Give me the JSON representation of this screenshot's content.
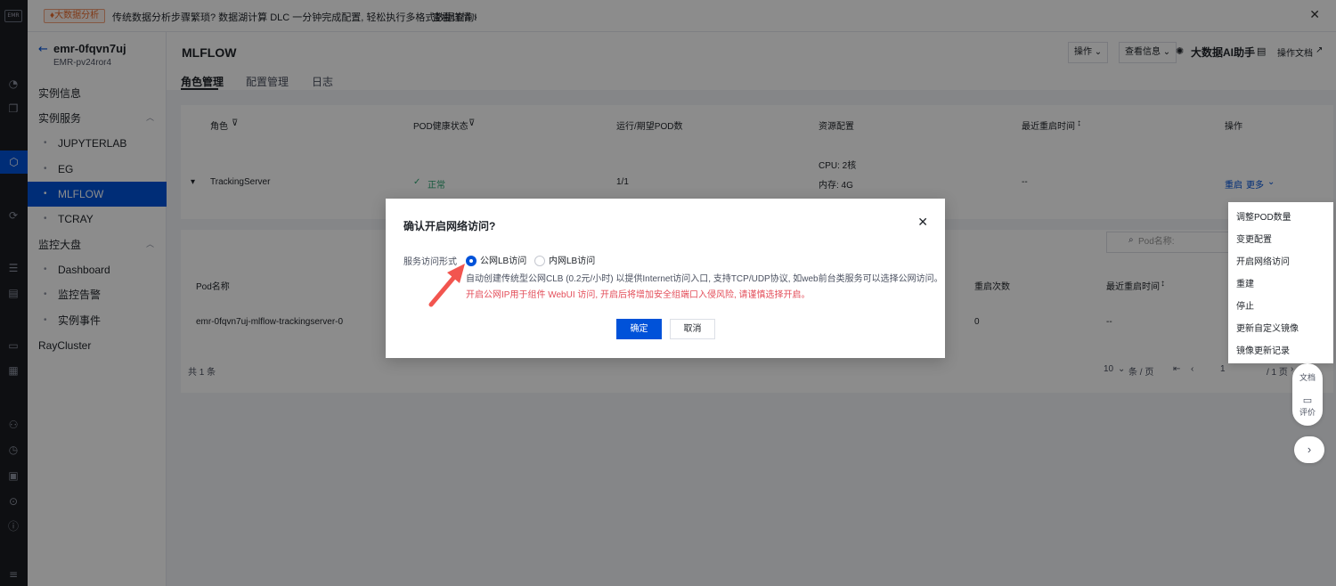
{
  "rail": {
    "logo": "EMR"
  },
  "banner": {
    "tag": "♦大数据分析",
    "message": "传统数据分析步骤繁琐? 数据湖计算 DLC 一分钟完成配置, 轻松执行多格式数据查询!",
    "more": "查看详情 ›"
  },
  "sidebar": {
    "instance_name": "emr-0fqvn7uj",
    "instance_id": "EMR-pv24ror4",
    "items": [
      {
        "label": "实例信息"
      },
      {
        "label": "实例服务"
      },
      {
        "label": "JUPYTERLAB"
      },
      {
        "label": "EG"
      },
      {
        "label": "MLFLOW"
      },
      {
        "label": "TCRAY"
      },
      {
        "label": "监控大盘"
      },
      {
        "label": "Dashboard"
      },
      {
        "label": "监控告警"
      },
      {
        "label": "实例事件"
      },
      {
        "label": "RayCluster"
      }
    ]
  },
  "header": {
    "title": "MLFLOW",
    "tabs": [
      "角色管理",
      "配置管理",
      "日志"
    ],
    "ops_btn": "操作 ⌄",
    "info_btn": "查看信息 ⌄",
    "ai": "大数据AI助手",
    "docs": "操作文档"
  },
  "role_table": {
    "headers": [
      "角色",
      "POD健康状态",
      "运行/期望POD数",
      "资源配置",
      "最近重启时间",
      "操作"
    ],
    "row": {
      "role": "TrackingServer",
      "health": "正常",
      "pods": "1/1",
      "cpu": "CPU: 2核",
      "mem": "内存: 4G",
      "restart_time": "--",
      "restart": "重启",
      "more": "更多"
    }
  },
  "pod_table": {
    "search_placeholder": "Pod名称:",
    "headers": [
      "Pod名称",
      "重启次数",
      "最近重启时间"
    ],
    "row": {
      "name": "emr-0fqvn7uj-mlflow-trackingserver-0",
      "restarts": "0",
      "restart_time": "--"
    },
    "total": "共 1 条",
    "page_size": "10",
    "per_page": "条 / 页",
    "page": "1",
    "pages": "/ 1 页"
  },
  "dropdown": [
    "调整POD数量",
    "变更配置",
    "开启网络访问",
    "重建",
    "停止",
    "更新自定义镜像",
    "镜像更新记录"
  ],
  "float": {
    "doc": "文档",
    "review": "评价"
  },
  "modal": {
    "title": "确认开启网络访问?",
    "label": "服务访问形式",
    "option_public": "公网LB访问",
    "option_private": "内网LB访问",
    "desc": "自动创建传统型公网CLB (0.2元/小时) 以提供Internet访问入口, 支持TCP/UDP协议, 如web前台类服务可以选择公网访问。",
    "warn": "开启公网IP用于组件 WebUI 访问, 开启后将增加安全组端口入侵风险, 请谨慎选择开启。",
    "ok": "确定",
    "cancel": "取消"
  },
  "colors": {
    "primary": "#0052d9",
    "danger": "#e34d59",
    "success": "#2ba471",
    "arrow": "#f2554f"
  }
}
